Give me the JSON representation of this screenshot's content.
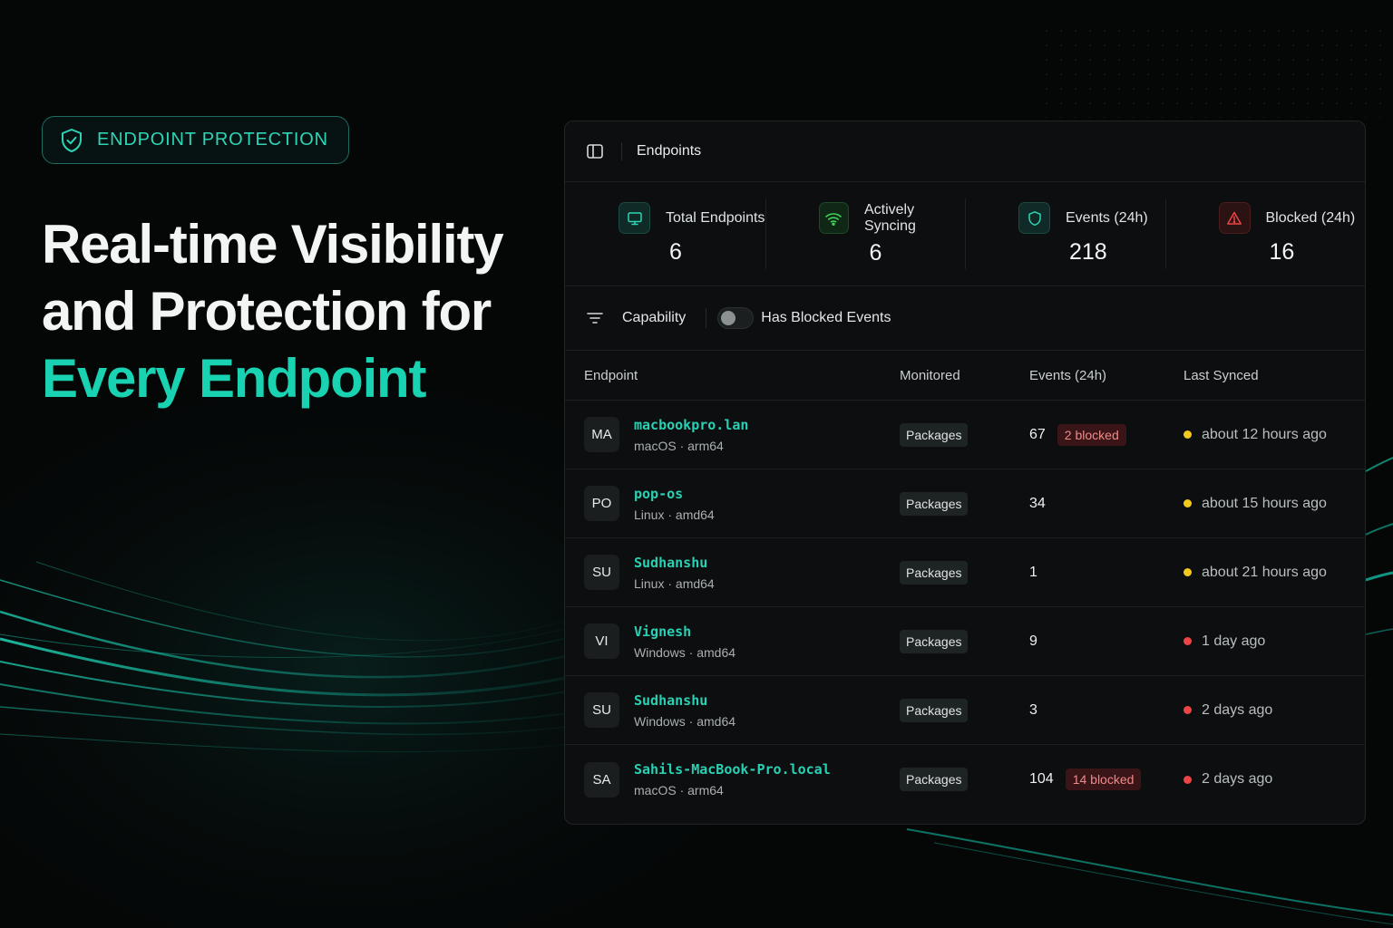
{
  "colors": {
    "accent": "#19d2b2",
    "status_recent": "#f2c91d",
    "status_stale": "#ef4444",
    "blocked_bg": "#3a1517"
  },
  "hero": {
    "badge_icon": "shield-check-icon",
    "badge": "ENDPOINT PROTECTION",
    "line1": "Real-time Visibility",
    "line2": "and Protection for",
    "line3": "Every Endpoint"
  },
  "panel": {
    "sidebar_icon": "sidebar-toggle-icon",
    "title": "Endpoints",
    "stats": [
      {
        "icon": "monitor-icon",
        "label": "Total Endpoints",
        "value": "6"
      },
      {
        "icon": "wifi-icon",
        "label": "Actively Syncing",
        "value": "6"
      },
      {
        "icon": "shield-icon",
        "label": "Events (24h)",
        "value": "218"
      },
      {
        "icon": "alert-triangle-icon",
        "label": "Blocked (24h)",
        "value": "16"
      }
    ],
    "filters": {
      "filter_icon": "filter-icon",
      "capability": "Capability",
      "toggle_label": "Has Blocked Events",
      "toggle_on": false
    },
    "columns": {
      "endpoint": "Endpoint",
      "monitored": "Monitored",
      "events": "Events (24h)",
      "last_synced": "Last Synced"
    },
    "rows": [
      {
        "initials": "MA",
        "name": "macbookpro.lan",
        "platform": "macOS · arm64",
        "monitored": "Packages",
        "events": "67",
        "blocked": "2 blocked",
        "synced": "about 12 hours ago",
        "status": "recent"
      },
      {
        "initials": "PO",
        "name": "pop-os",
        "platform": "Linux · amd64",
        "monitored": "Packages",
        "events": "34",
        "blocked": "",
        "synced": "about 15 hours ago",
        "status": "recent"
      },
      {
        "initials": "SU",
        "name": "Sudhanshu",
        "platform": "Linux · amd64",
        "monitored": "Packages",
        "events": "1",
        "blocked": "",
        "synced": "about 21 hours ago",
        "status": "recent"
      },
      {
        "initials": "VI",
        "name": "Vignesh",
        "platform": "Windows · amd64",
        "monitored": "Packages",
        "events": "9",
        "blocked": "",
        "synced": "1 day ago",
        "status": "stale"
      },
      {
        "initials": "SU",
        "name": "Sudhanshu",
        "platform": "Windows · amd64",
        "monitored": "Packages",
        "events": "3",
        "blocked": "",
        "synced": "2 days ago",
        "status": "stale"
      },
      {
        "initials": "SA",
        "name": "Sahils-MacBook-Pro.local",
        "platform": "macOS · arm64",
        "monitored": "Packages",
        "events": "104",
        "blocked": "14 blocked",
        "synced": "2 days ago",
        "status": "stale"
      }
    ]
  }
}
